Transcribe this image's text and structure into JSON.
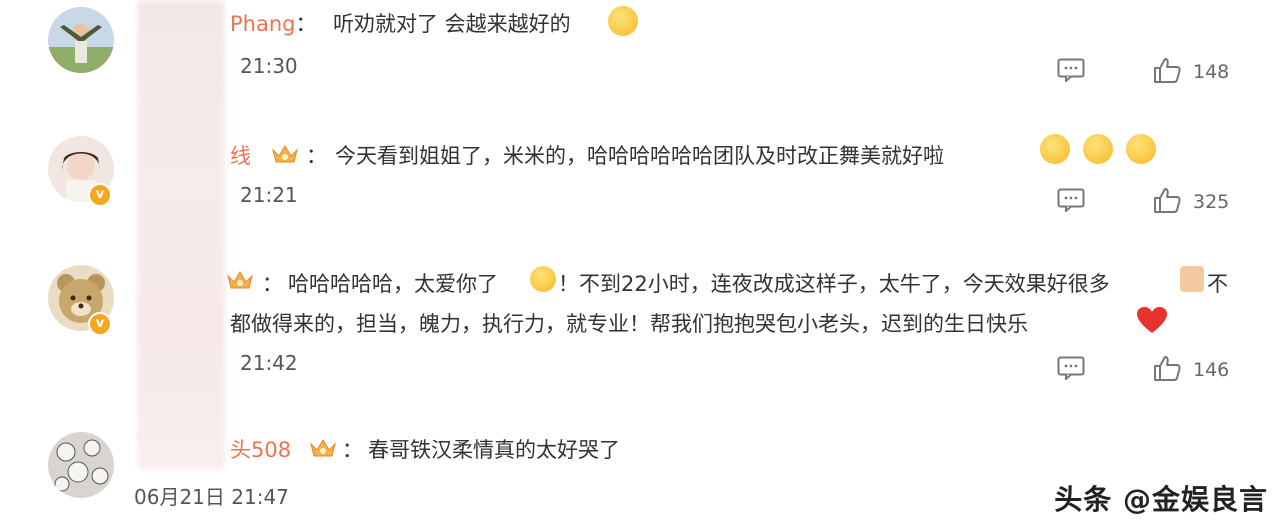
{
  "comments": [
    {
      "username": "Phang",
      "text": "听劝就对了 会越来越好的",
      "time": "21:30",
      "likes": "148"
    },
    {
      "username": "线",
      "text": "今天看到姐姐了，米米的，哈哈哈哈哈哈团队及时改正舞美就好啦",
      "time": "21:21",
      "likes": "325"
    },
    {
      "username": "",
      "text_line1a": "哈哈哈哈哈，太爱你了",
      "text_line1b": "！不到22小时，连夜改成这样子，太牛了，今天效果好很多",
      "text_line1c": "不",
      "text_line2": "都做得来的，担当，魄力，执行力，就专业！帮我们抱抱哭包小老头，迟到的生日快乐",
      "time": "21:42",
      "likes": "146"
    },
    {
      "username": "头508",
      "text": "春哥铁汉柔情真的太好哭了",
      "time": "06月21日 21:47"
    }
  ],
  "colon": "：",
  "watermark": "头条 @金娱良言",
  "colors": {
    "username": "#eb7350",
    "verified": "#f5a623",
    "text": "#333333"
  }
}
